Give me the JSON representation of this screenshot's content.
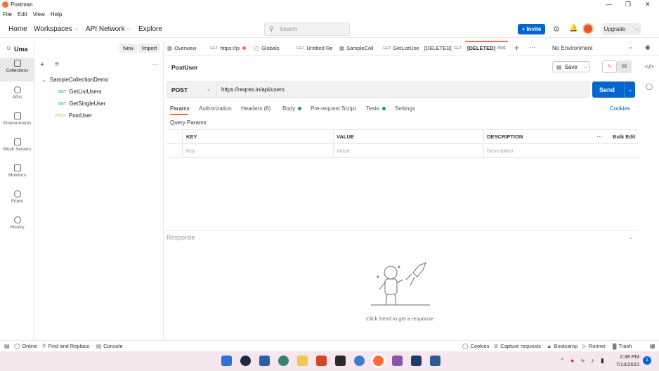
{
  "window": {
    "title": "Postman"
  },
  "menu": [
    "File",
    "Edit",
    "View",
    "Help"
  ],
  "topnav": {
    "home": "Home",
    "workspaces": "Workspaces",
    "api_network": "API Network",
    "explore": "Explore",
    "search_placeholder": "Search",
    "invite": "Invite",
    "upgrade": "Upgrade"
  },
  "rail": [
    {
      "label": "Collections",
      "icon": "collections-icon"
    },
    {
      "label": "APIs",
      "icon": "apis-icon"
    },
    {
      "label": "Environments",
      "icon": "environments-icon"
    },
    {
      "label": "Mock Servers",
      "icon": "mock-servers-icon"
    },
    {
      "label": "Monitors",
      "icon": "monitors-icon"
    },
    {
      "label": "Flows",
      "icon": "flows-icon"
    },
    {
      "label": "History",
      "icon": "history-icon"
    }
  ],
  "sidebar": {
    "user": "Uma",
    "new_label": "New",
    "import_label": "Import",
    "collection": "SampleCollectionDemo",
    "requests": [
      {
        "method": "GET",
        "name": "GetListUsers"
      },
      {
        "method": "GET",
        "name": "GetSingleUser"
      },
      {
        "method": "POST",
        "name": "PostUser"
      }
    ]
  },
  "tabs": [
    {
      "method": "",
      "label": "Overview"
    },
    {
      "method": "GET",
      "label": "https://js"
    },
    {
      "method": "",
      "label": "Globals"
    },
    {
      "method": "GET",
      "label": "Untitled Re"
    },
    {
      "method": "",
      "label": "SampleColl"
    },
    {
      "method": "GET",
      "label": "GetListUse"
    },
    {
      "method": "GET",
      "label": "[DELETED]"
    },
    {
      "method": "POS",
      "label": "[DELETED]"
    }
  ],
  "environment": "No Environment",
  "request": {
    "name": "PostUser",
    "save_label": "Save",
    "method": "POST",
    "url": "https://reqres.in/api/users",
    "send_label": "Send"
  },
  "subtabs": {
    "params": "Params",
    "authorization": "Authorization",
    "headers": "Headers (8)",
    "body": "Body",
    "prerequest": "Pre-request Script",
    "tests": "Tests",
    "settings": "Settings",
    "cookies": "Cookies"
  },
  "params": {
    "section_title": "Query Params",
    "headers": [
      "KEY",
      "VALUE",
      "DESCRIPTION"
    ],
    "bulk_edit": "Bulk Edit",
    "placeholders": [
      "Key",
      "Value",
      "Description"
    ]
  },
  "response": {
    "label": "Response",
    "hint": "Click Send to get a response"
  },
  "statusbar": {
    "online": "Online",
    "find_replace": "Find and Replace",
    "console": "Console",
    "cookies": "Cookies",
    "capture": "Capture requests",
    "bootcamp": "Bootcamp",
    "runner": "Runner",
    "trash": "Trash"
  },
  "taskbar": {
    "time": "2:38 PM",
    "date": "7/13/2022",
    "notification_count": "1"
  },
  "colors": {
    "accent": "#ff6c37",
    "primary": "#0265d2",
    "get": "#0f9d58",
    "post": "#e7a234"
  }
}
